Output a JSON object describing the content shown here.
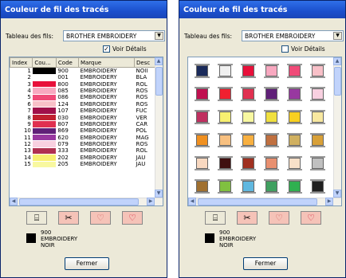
{
  "window_title": "Couleur de fil des tracés",
  "table_label": "Tableau des fils:",
  "table_value": "BROTHER EMBROIDERY",
  "details_label": "Voir Détails",
  "columns": [
    "Index",
    "Cou...",
    "Code",
    "Marque",
    "Desc"
  ],
  "rows": [
    {
      "index": "1",
      "color": "#000000",
      "code": "900",
      "brand": "EMBROIDERY",
      "desc": "NOII"
    },
    {
      "index": "2",
      "color": "#ffffff",
      "code": "001",
      "brand": "EMBROIDERY",
      "desc": "BLA"
    },
    {
      "index": "3",
      "color": "#e8103a",
      "code": "800",
      "brand": "EMBROIDERY",
      "desc": "ROL"
    },
    {
      "index": "4",
      "color": "#f8a8c0",
      "code": "085",
      "brand": "EMBROIDERY",
      "desc": "ROS"
    },
    {
      "index": "5",
      "color": "#f04a78",
      "code": "086",
      "brand": "EMBROIDERY",
      "desc": "ROS"
    },
    {
      "index": "6",
      "color": "#f8c0c8",
      "code": "124",
      "brand": "EMBROIDERY",
      "desc": "ROS"
    },
    {
      "index": "7",
      "color": "#a0104a",
      "code": "107",
      "brand": "EMBROIDERY",
      "desc": "FUC"
    },
    {
      "index": "8",
      "color": "#c02030",
      "code": "030",
      "brand": "EMBROIDERY",
      "desc": "VER"
    },
    {
      "index": "9",
      "color": "#e03050",
      "code": "807",
      "brand": "EMBROIDERY",
      "desc": "CAR"
    },
    {
      "index": "10",
      "color": "#602078",
      "code": "869",
      "brand": "EMBROIDERY",
      "desc": "POL"
    },
    {
      "index": "11",
      "color": "#9838a0",
      "code": "620",
      "brand": "EMBROIDERY",
      "desc": "MAG"
    },
    {
      "index": "12",
      "color": "#f8d0e0",
      "code": "079",
      "brand": "EMBROIDERY",
      "desc": "ROS"
    },
    {
      "index": "13",
      "color": "#b03050",
      "code": "333",
      "brand": "EMBROIDERY",
      "desc": "ROL"
    },
    {
      "index": "14",
      "color": "#f8f070",
      "code": "202",
      "brand": "EMBROIDERY",
      "desc": "JAU"
    },
    {
      "index": "15",
      "color": "#f8f8a0",
      "code": "205",
      "brand": "EMBROIDERY",
      "desc": "JAU"
    }
  ],
  "spool_colors": [
    [
      "#1a2a5a",
      "#f0f0f0",
      "#e8103a",
      "#f8a8c0",
      "#f04a78",
      "#f8c0c8"
    ],
    [
      "#c01050",
      "#f02030",
      "#e03050",
      "#602078",
      "#9838a0",
      "#f8d0e0"
    ],
    [
      "#c03060",
      "#f8f070",
      "#f8f8a0",
      "#f0e040",
      "#f8d020",
      "#f8e8a0"
    ],
    [
      "#f09020",
      "#f8c080",
      "#f8b040",
      "#c07040",
      "#d0b060",
      "#d8a038"
    ],
    [
      "#f8d8c0",
      "#401010",
      "#a03020",
      "#e89070",
      "#f8e0c8",
      "#c0c0c0"
    ],
    [
      "#a07030",
      "#80c040",
      "#60b8e0",
      "#40a060",
      "#30b050",
      "#202020"
    ]
  ],
  "tool_buttons": [
    {
      "label": "spool",
      "glyph": "⌸"
    },
    {
      "label": "scissors",
      "glyph": "✂"
    },
    {
      "label": "heart-outline",
      "glyph": "♡"
    },
    {
      "label": "heart",
      "glyph": "♡"
    }
  ],
  "selected": {
    "code": "900",
    "brand": "EMBROIDERY",
    "name": "NOIR",
    "color": "#000000"
  },
  "close_label": "Fermer"
}
